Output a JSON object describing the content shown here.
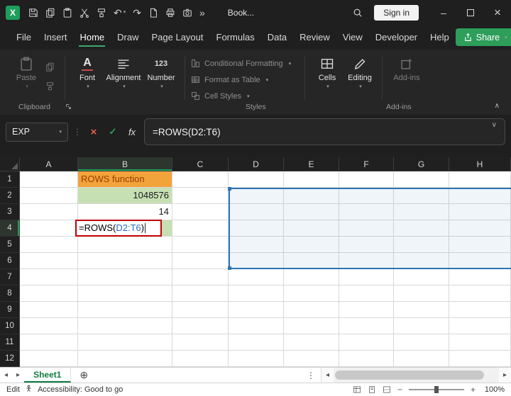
{
  "titlebar": {
    "logo_letter": "X",
    "workbook_name": "Book...",
    "sign_in": "Sign in"
  },
  "menubar": {
    "tabs": [
      "File",
      "Insert",
      "Home",
      "Draw",
      "Page Layout",
      "Formulas",
      "Data",
      "Review",
      "View",
      "Developer",
      "Help"
    ],
    "active_tab": "Home",
    "share": "Share"
  },
  "ribbon": {
    "paste": "Paste",
    "font": "Font",
    "alignment": "Alignment",
    "number": "Number",
    "styles": [
      "Conditional Formatting",
      "Format as Table",
      "Cell Styles"
    ],
    "cells": "Cells",
    "editing": "Editing",
    "addins": "Add-ins",
    "group_labels": [
      "Clipboard",
      "Styles",
      "Add-ins"
    ]
  },
  "formula_bar": {
    "name_box": "EXP",
    "fx": "fx",
    "formula": "=ROWS(D2:T6)"
  },
  "grid": {
    "columns": [
      "A",
      "B",
      "C",
      "D",
      "E",
      "F",
      "G",
      "H"
    ],
    "rows": [
      "1",
      "2",
      "3",
      "4",
      "5",
      "6",
      "7",
      "8",
      "9",
      "10",
      "11",
      "12"
    ],
    "cells": {
      "B1": "ROWS function",
      "B2": "1048576",
      "B3": "14",
      "B4": {
        "prefix": "=ROWS(",
        "range": "D2:T6",
        "suffix": ")"
      }
    },
    "active_cell": {
      "column": "B",
      "row": "4"
    },
    "selected_range": "D2:T6"
  },
  "sheet_bar": {
    "sheet_name": "Sheet1"
  },
  "status_bar": {
    "mode": "Edit",
    "accessibility": "Accessibility: Good to go",
    "zoom": "100%"
  },
  "icons": {
    "dropdown": "▾",
    "undo": "↶",
    "redo": "↷",
    "overflow": "»",
    "minimize": "–",
    "close": "×",
    "collapse_ribbon": "∧",
    "formula_expand": "∨",
    "separator": "⋮",
    "cancel": "×",
    "enter": "✓",
    "font": "A",
    "number": "123",
    "add_sheet": "⊕",
    "sheet_more": "⋮",
    "nav_left": "◂",
    "nav_right": "▸"
  },
  "colors": {
    "excel_green": "#1E9E5A",
    "share_green": "#2E9E5B",
    "tab_underline": "#3FA86B",
    "orange_fill": "#F2A33C",
    "orange_text": "#9C3A00",
    "green_fill": "#C6E0B4",
    "range_blue": "#2E75B6",
    "ref_blue": "#2B6CC4",
    "annotation_red": "#C00000",
    "sheet_green": "#107C41"
  }
}
